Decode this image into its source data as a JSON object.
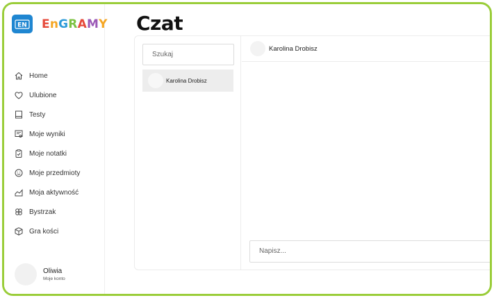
{
  "app": {
    "logo_mark_text": "EN",
    "logo_text": "EnGRAMY"
  },
  "sidebar": {
    "items": [
      {
        "label": "Home",
        "icon": "home-icon"
      },
      {
        "label": "Ulubione",
        "icon": "heart-icon"
      },
      {
        "label": "Testy",
        "icon": "book-icon"
      },
      {
        "label": "Moje wyniki",
        "icon": "certificate-icon"
      },
      {
        "label": "Moje notatki",
        "icon": "clipboard-check-icon"
      },
      {
        "label": "Moje przedmioty",
        "icon": "smile-icon"
      },
      {
        "label": "Moja aktywność",
        "icon": "chart-area-icon"
      },
      {
        "label": "Bystrzak",
        "icon": "clover-icon"
      },
      {
        "label": "Gra kości",
        "icon": "cube-icon"
      }
    ],
    "user": {
      "name": "Oliwia",
      "subtitle": "Moje konto"
    }
  },
  "page": {
    "title": "Czat"
  },
  "chat": {
    "search_placeholder": "Szukaj",
    "contacts": [
      {
        "name": "Karolina Drobisz"
      }
    ],
    "active_contact": "Karolina Drobisz",
    "compose_placeholder": "Napisz..."
  },
  "colors": {
    "frame_border": "#9acd3a",
    "logo_bg": "#1f86d1",
    "selected_contact_bg": "#ededed"
  }
}
